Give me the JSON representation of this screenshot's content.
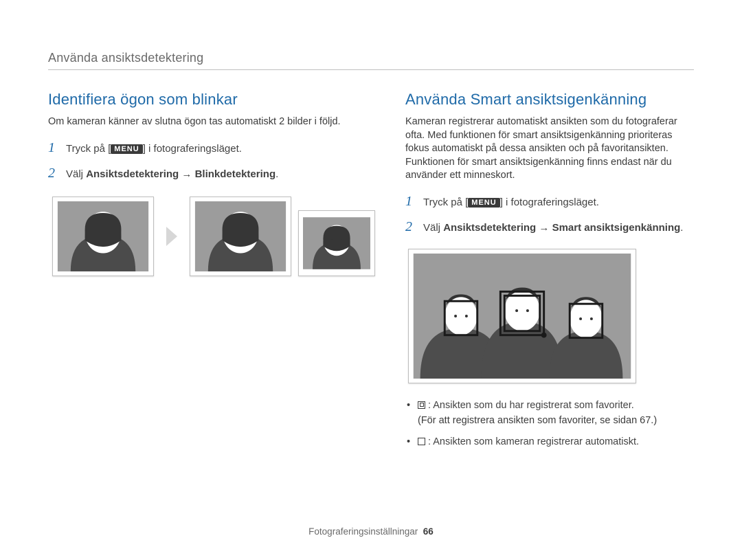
{
  "breadcrumb": "Använda ansiktsdetektering",
  "left": {
    "heading": "Identifiera ögon som blinkar",
    "intro": "Om kameran känner av slutna ögon tas automatiskt 2 bilder i följd.",
    "steps": {
      "s1_num": "1",
      "s1_pre": "Tryck på [",
      "s1_menu": "MENU",
      "s1_post": "] i fotograferingsläget.",
      "s2_num": "2",
      "s2_pre": "Välj ",
      "s2_bold1": "Ansiktsdetektering",
      "s2_arrow": " → ",
      "s2_bold2": "Blinkdetektering",
      "s2_post": "."
    }
  },
  "right": {
    "heading": "Använda Smart ansiktsigenkänning",
    "intro": "Kameran registrerar automatiskt ansikten som du fotograferar ofta. Med funktionen för smart ansiktsigenkänning prioriteras fokus automatiskt på dessa ansikten och på favoritansikten. Funktionen för smart ansiktsigenkänning finns endast när du använder ett minneskort.",
    "steps": {
      "s1_num": "1",
      "s1_pre": "Tryck på [",
      "s1_menu": "MENU",
      "s1_post": "] i fotograferingsläget.",
      "s2_num": "2",
      "s2_pre": "Välj ",
      "s2_bold1": "Ansiktsdetektering",
      "s2_arrow": " → ",
      "s2_bold2": "Smart ansiktsigenkänning",
      "s2_post": "."
    },
    "bullets": {
      "b1_main": ": Ansikten som du har registrerat som favoriter.",
      "b1_sub": "(För att registrera ansikten som favoriter, se sidan 67.)",
      "b2_main": ": Ansikten som kameran registrerar automatiskt."
    }
  },
  "footer": {
    "label": "Fotograferingsinställningar",
    "page": "66"
  }
}
